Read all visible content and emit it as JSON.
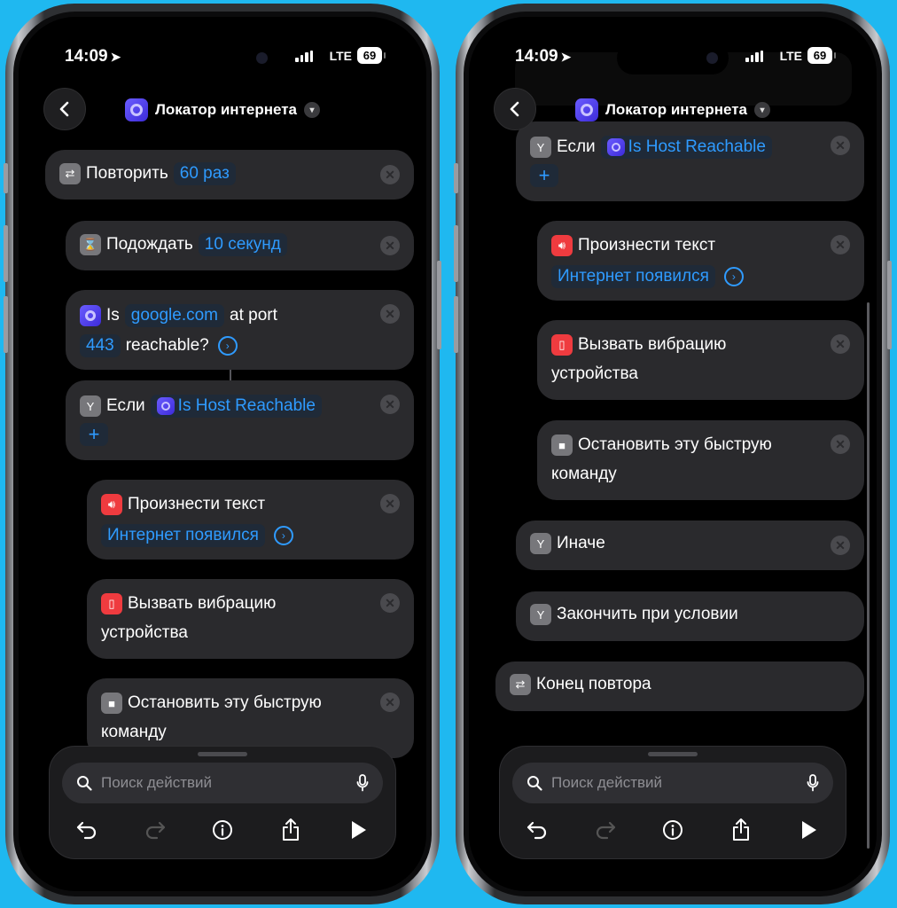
{
  "status": {
    "time": "14:09",
    "network": "LTE",
    "battery": "69"
  },
  "nav": {
    "title": "Локатор интернета"
  },
  "actions": {
    "repeat": {
      "label": "Повторить",
      "count": "60 раз"
    },
    "wait": {
      "label": "Подождать",
      "duration": "10 секунд"
    },
    "host": {
      "is": "Is",
      "host": "google.com",
      "at_port": "at port",
      "port": "443",
      "reachable": "reachable?"
    },
    "if": {
      "label": "Если",
      "var": "Is Host Reachable",
      "plus": "+"
    },
    "speak": {
      "label": "Произнести текст",
      "text": "Интернет появился"
    },
    "vibrate": {
      "line1": "Вызвать вибрацию",
      "line2": "устройства"
    },
    "stop": {
      "line1": "Остановить эту быструю",
      "line2": "команду"
    },
    "otherwise": {
      "label": "Иначе"
    },
    "end_if": {
      "label": "Закончить при условии"
    },
    "end_repeat": {
      "label": "Конец повтора"
    }
  },
  "search": {
    "placeholder": "Поиск действий"
  },
  "colors": {
    "background": "#1fb8f0",
    "accent": "#2f9bff",
    "card": "#2a2a2d",
    "red_icon": "#ef3b3f",
    "purple_icon": "#5a4cf0"
  }
}
